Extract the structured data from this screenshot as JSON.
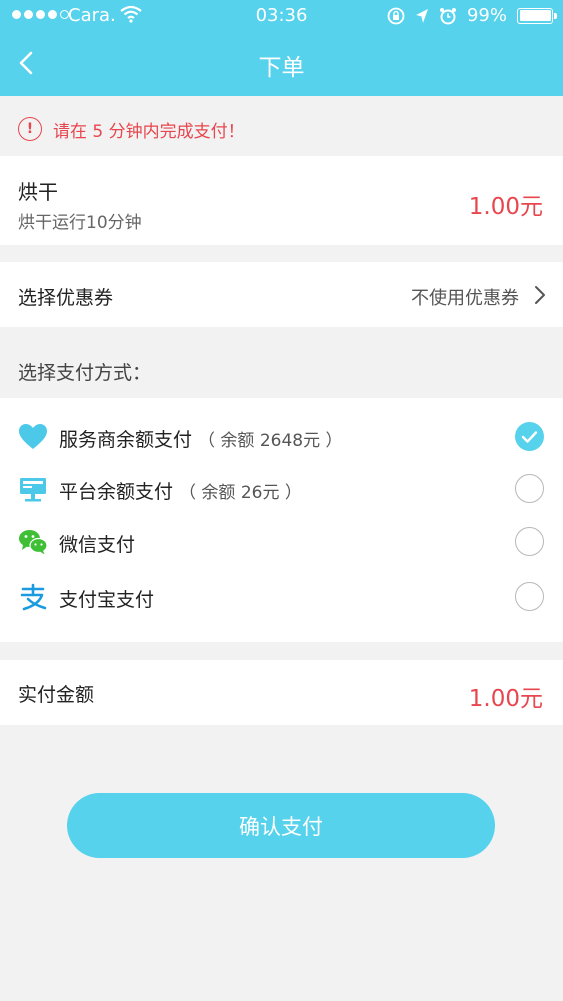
{
  "status_bar": {
    "carrier": "Cara.",
    "time": "03:36",
    "battery": "99%"
  },
  "nav": {
    "title": "下单",
    "back_icon": "chevron-left-icon"
  },
  "notice": {
    "text": "请在 5 分钟内完成支付！",
    "color": "#e8464e"
  },
  "order": {
    "name": "烘干",
    "description": "烘干运行10分钟",
    "price": "1.00元"
  },
  "coupon": {
    "label": "选择优惠券",
    "value": "不使用优惠券"
  },
  "payment": {
    "section_label": "选择支付方式：",
    "methods": [
      {
        "label": "服务商余额支付",
        "balance": "（ 余额 2648元 ）",
        "icon": "heart-icon",
        "selected": true
      },
      {
        "label": "平台余额支付",
        "balance": "（ 余额 26元 ）",
        "icon": "terminal-icon",
        "selected": false
      },
      {
        "label": "微信支付",
        "balance": "",
        "icon": "wechat-icon",
        "selected": false
      },
      {
        "label": "支付宝支付",
        "balance": "",
        "icon": "alipay-icon",
        "selected": false
      }
    ]
  },
  "actual_payment": {
    "label": "实付金额",
    "amount": "1.00元"
  },
  "confirm_button": {
    "label": "确认支付"
  },
  "colors": {
    "accent": "#56d2ec",
    "price": "#e8464e",
    "background": "#f2f2f2"
  }
}
